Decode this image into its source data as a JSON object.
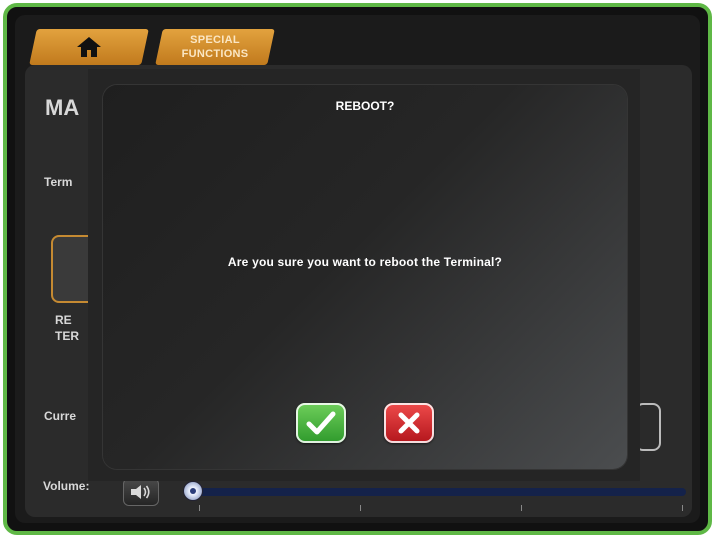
{
  "tabs": {
    "home": {
      "icon": "home-icon"
    },
    "special_functions": {
      "label": "SPECIAL FUNCTIONS"
    }
  },
  "background": {
    "title": "MA",
    "terminal_label": "Term",
    "reboot_tile_label_line1": "RE",
    "reboot_tile_label_line2": "TER",
    "current_label": "Curre",
    "volume_label": "Volume:"
  },
  "volume": {
    "level": 0,
    "icon": "speaker-icon"
  },
  "dialog": {
    "title": "REBOOT?",
    "message": "Are you sure you want to reboot the Terminal?",
    "confirm_icon": "checkmark-icon",
    "cancel_icon": "close-icon"
  },
  "colors": {
    "frame_border": "#5fb846",
    "tab_orange": "#d08e2e",
    "confirm_green": "#3aa736",
    "cancel_red": "#d42328",
    "slider_blue": "#14224a"
  }
}
